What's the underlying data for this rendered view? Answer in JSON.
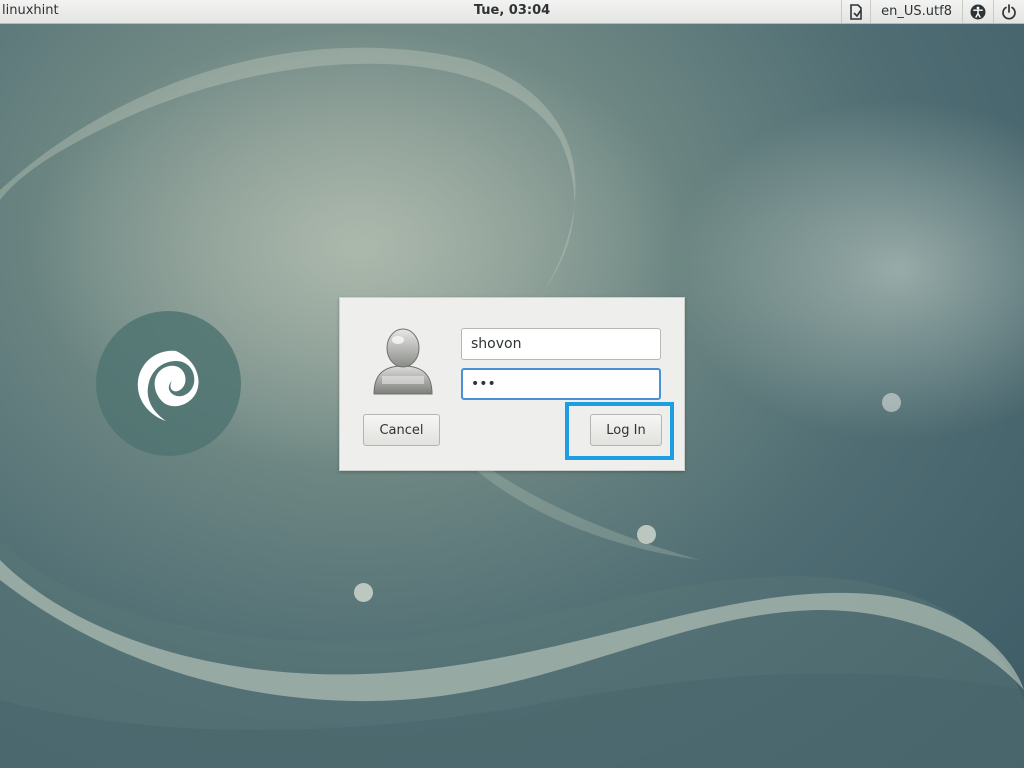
{
  "top_panel": {
    "hostname": "linuxhint",
    "clock": "Tue, 03:04",
    "keyboard_layout": "en_US.utf8",
    "icons": [
      "document-icon",
      "accessibility-icon",
      "power-icon"
    ]
  },
  "login": {
    "username_value": "shovon",
    "password_value": "•••",
    "cancel_label": "Cancel",
    "login_label": "Log In"
  },
  "colors": {
    "highlight": "#1e9ee0",
    "focus": "#4a90d9",
    "dialog_bg": "#eeeeec"
  }
}
